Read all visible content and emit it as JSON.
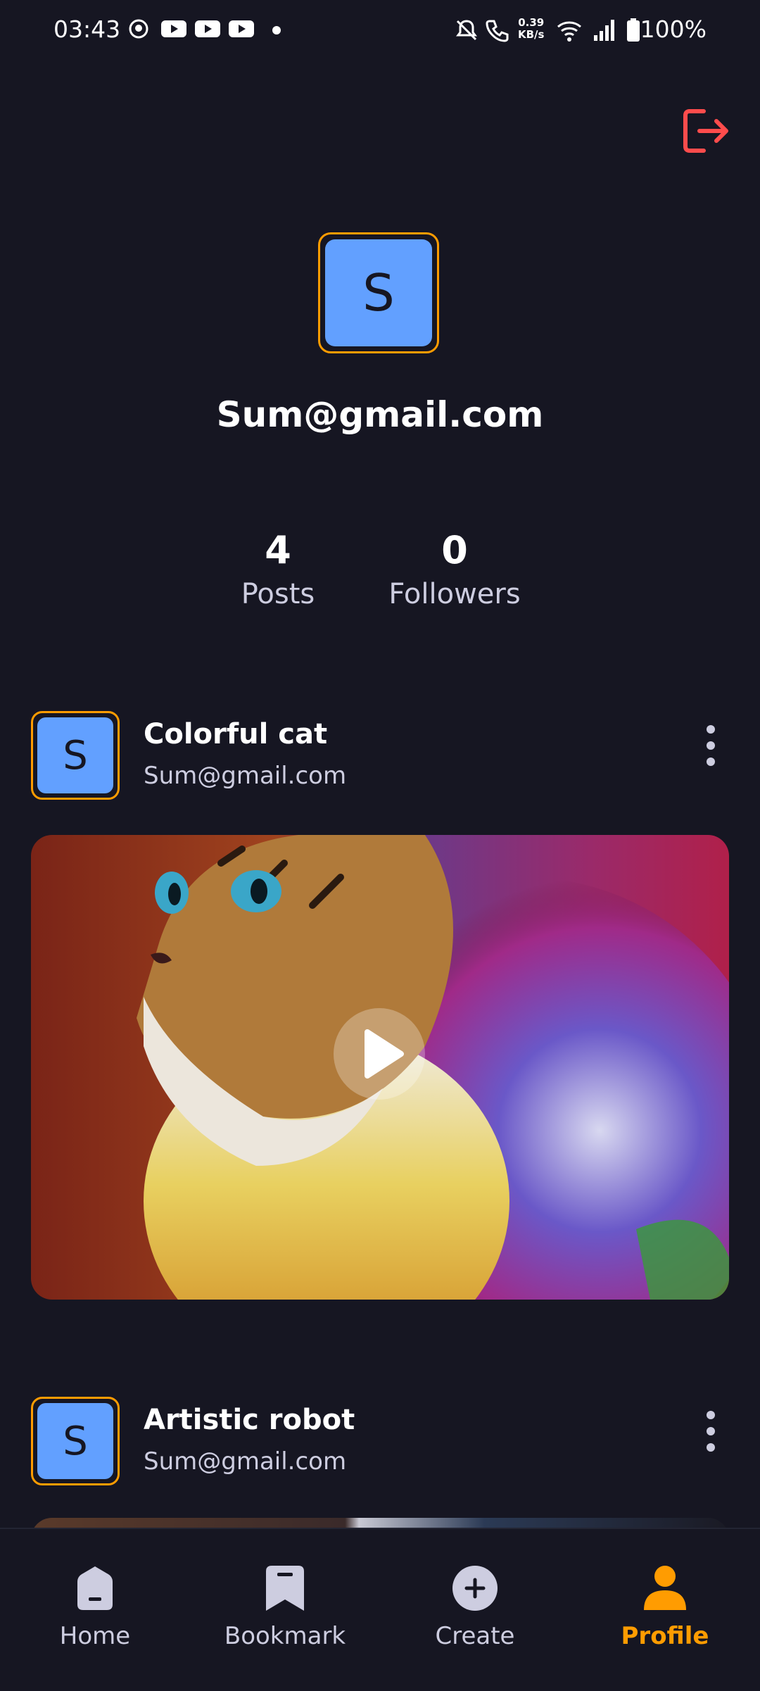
{
  "status_bar": {
    "time": "03:43",
    "network_speed_value": "0.39",
    "network_speed_unit": "KB/s",
    "battery": "100%"
  },
  "profile": {
    "avatar_letter": "S",
    "email": "Sum@gmail.com",
    "stats": [
      {
        "value": "4",
        "label": "Posts"
      },
      {
        "value": "0",
        "label": "Followers"
      }
    ]
  },
  "posts": [
    {
      "avatar_letter": "S",
      "title": "Colorful cat",
      "author": "Sum@gmail.com"
    },
    {
      "avatar_letter": "S",
      "title": "Artistic robot",
      "author": "Sum@gmail.com"
    }
  ],
  "bottom_nav": [
    {
      "label": "Home",
      "icon": "home-icon"
    },
    {
      "label": "Bookmark",
      "icon": "bookmark-icon"
    },
    {
      "label": "Create",
      "icon": "plus-circle-icon"
    },
    {
      "label": "Profile",
      "icon": "profile-icon",
      "active": true
    }
  ],
  "colors": {
    "background": "#161622",
    "accent": "#ff9c01",
    "avatar": "#62a0ff",
    "logout": "#ff4c4c",
    "muted_text": "#cdcde0"
  }
}
